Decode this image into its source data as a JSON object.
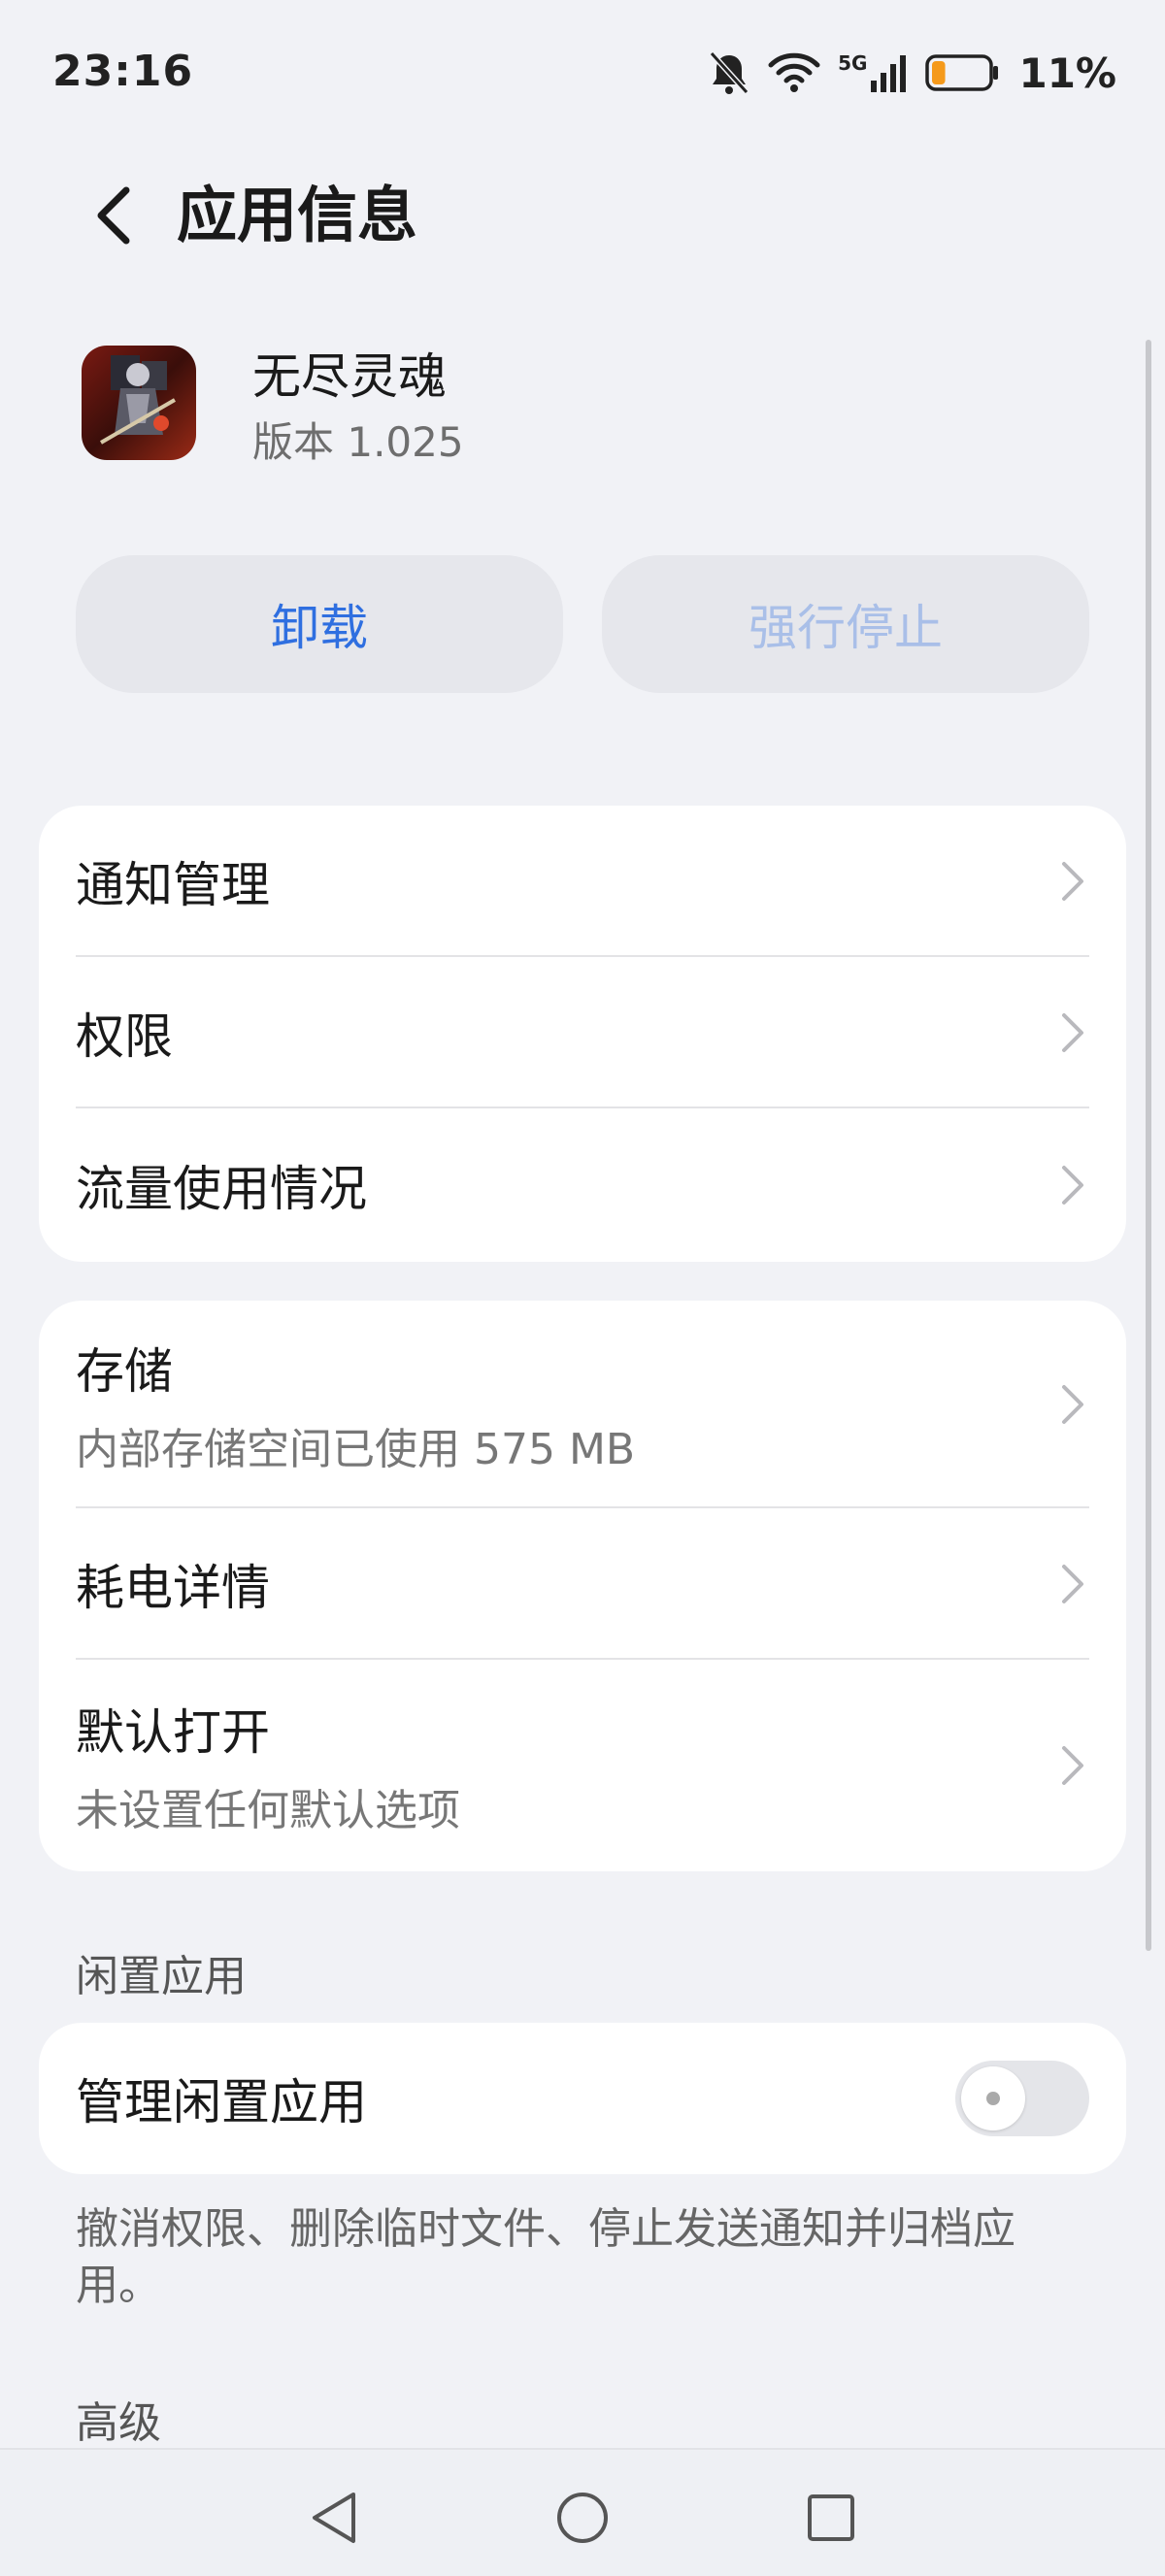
{
  "status_bar": {
    "time": "23:16",
    "network": "5G",
    "battery_percent": "11%",
    "battery_level": 0.11,
    "icons": [
      "bell-muted-icon",
      "wifi-icon",
      "signal-icon",
      "battery-icon"
    ]
  },
  "header": {
    "title": "应用信息"
  },
  "app": {
    "name": "无尽灵魂",
    "version": "版本 1.025"
  },
  "actions": {
    "uninstall": "卸载",
    "force_stop": "强行停止",
    "force_stop_enabled": false
  },
  "card1": {
    "rows": [
      {
        "title": "通知管理"
      },
      {
        "title": "权限"
      },
      {
        "title": "流量使用情况"
      }
    ]
  },
  "card2": {
    "rows": [
      {
        "title": "存储",
        "subtitle": "内部存储空间已使用 575 MB"
      },
      {
        "title": "耗电详情"
      },
      {
        "title": "默认打开",
        "subtitle": "未设置任何默认选项"
      }
    ]
  },
  "idle_apps": {
    "section_label": "闲置应用",
    "toggle_label": "管理闲置应用",
    "toggle_on": false,
    "description": "撤消权限、删除临时文件、停止发送通知并归档应用。"
  },
  "advanced": {
    "section_label": "高级"
  },
  "colors": {
    "accent": "#2f6fe0",
    "accent_disabled": "#a9bfe8",
    "background": "#f1f2f6",
    "battery_low": "#f59a1b"
  }
}
